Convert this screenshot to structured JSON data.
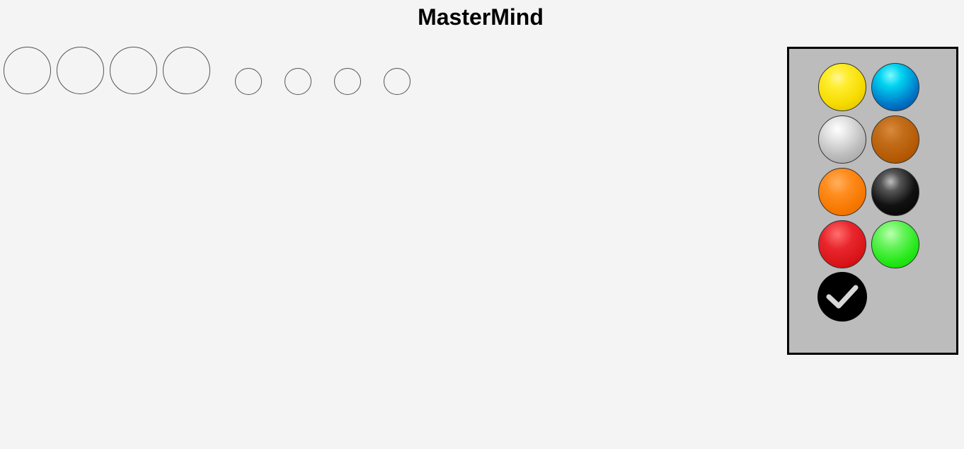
{
  "title": "MasterMind",
  "palette": {
    "pegs": [
      {
        "name": "yellow",
        "color": "#f6dc00"
      },
      {
        "name": "cyan",
        "color": "#0088d0"
      },
      {
        "name": "silver",
        "color": "#c4c4c4"
      },
      {
        "name": "brown",
        "color": "#b55a05"
      },
      {
        "name": "orange",
        "color": "#f77700"
      },
      {
        "name": "black",
        "color": "#000000"
      },
      {
        "name": "red",
        "color": "#d81418"
      },
      {
        "name": "green",
        "color": "#22e816"
      }
    ],
    "submit_icon": "check-icon"
  },
  "current_guess": {
    "slots": [
      "",
      "",
      "",
      ""
    ],
    "feedback": [
      "",
      "",
      "",
      ""
    ]
  }
}
